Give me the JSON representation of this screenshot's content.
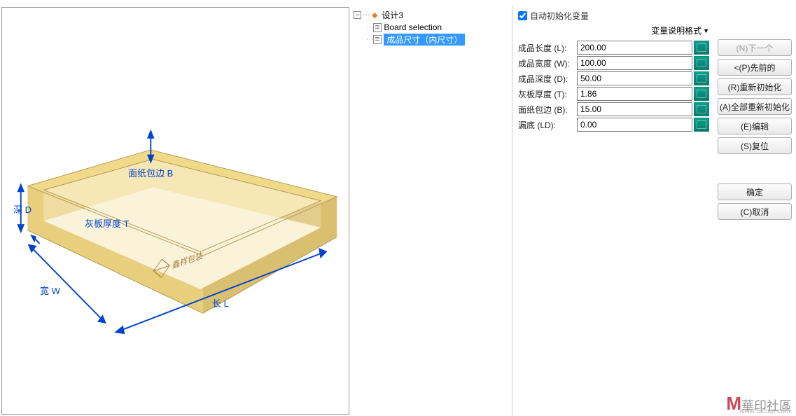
{
  "tree": {
    "root": "设计3",
    "child1": "Board selection",
    "child2": "成品尺寸（内尺寸）"
  },
  "checkbox_label": "自动初始化变量",
  "dropdown_label": "变量说明格式",
  "params": [
    {
      "label": "成品长度 (L):",
      "value": "200.00"
    },
    {
      "label": "成品宽度 (W):",
      "value": "100.00"
    },
    {
      "label": "成品深度 (D):",
      "value": "50.00"
    },
    {
      "label": "灰板厚度 (T):",
      "value": "1.86"
    },
    {
      "label": "面纸包边 (B):",
      "value": "15.00"
    },
    {
      "label": "漏底 (LD):",
      "value": "0.00"
    }
  ],
  "buttons": {
    "next": "(N)下一个",
    "prev": "<(P)先前的",
    "reinit": "(R)重新初始化",
    "reinit_all": "(A)全部重新初始化",
    "edit": "(E)编辑",
    "reset": "(S)复位",
    "ok": "确定",
    "cancel": "(C)取消"
  },
  "dims": {
    "wrap": "面纸包边  B",
    "thick": "灰板厚度  T",
    "depth": "深 D",
    "width": "宽 W",
    "length": "长 L"
  },
  "box_logo": "鑫祥包装",
  "watermark": {
    "brand": "華印社區",
    "url": "www.52cnp.com"
  }
}
